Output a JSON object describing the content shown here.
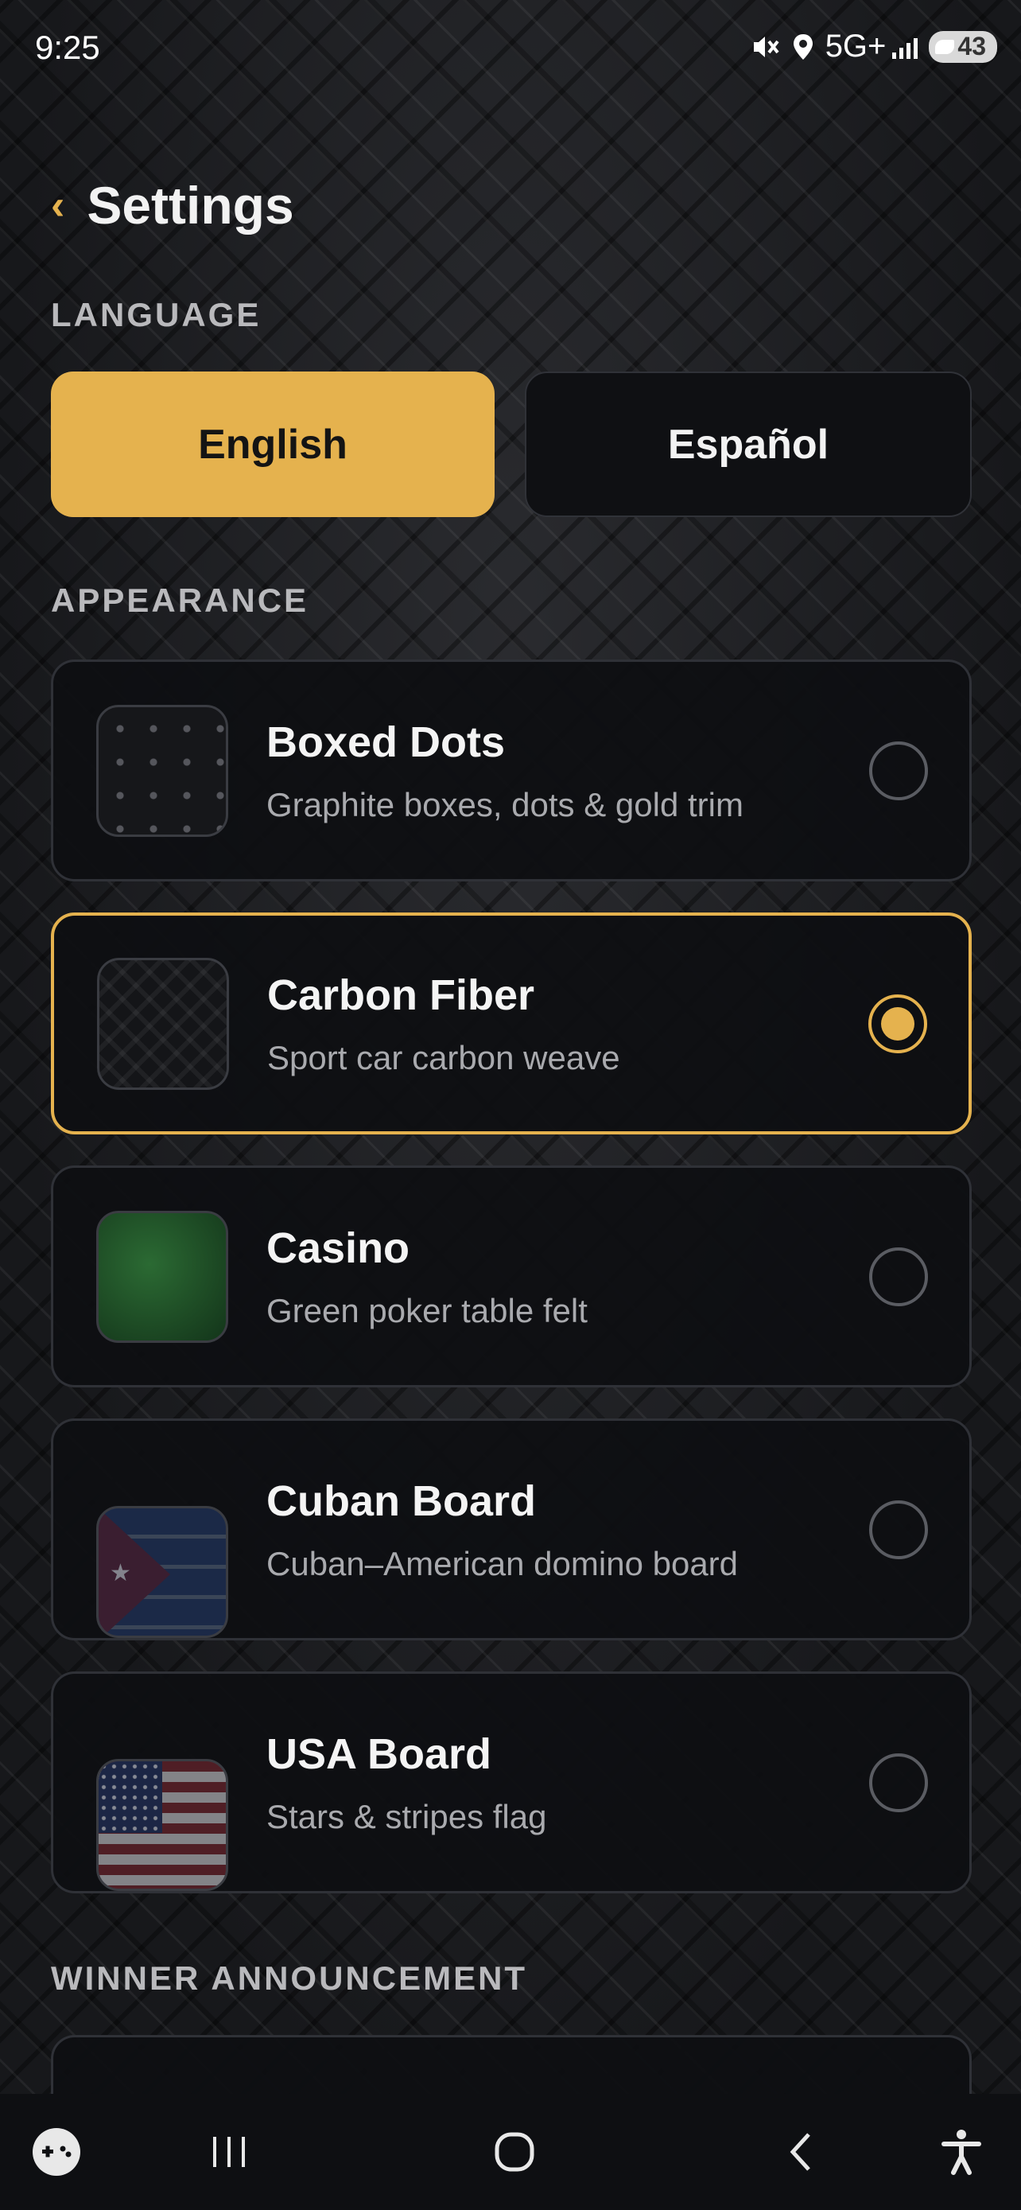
{
  "status_bar": {
    "time": "9:25",
    "network": "5G+",
    "battery": "43"
  },
  "header": {
    "title": "Settings"
  },
  "language": {
    "label": "LANGUAGE",
    "options": [
      {
        "label": "English",
        "selected": true
      },
      {
        "label": "Español",
        "selected": false
      }
    ]
  },
  "appearance": {
    "label": "APPEARANCE",
    "themes": [
      {
        "title": "Boxed Dots",
        "subtitle": "Graphite boxes, dots & gold trim",
        "selected": false,
        "thumbnail": "boxed-dots"
      },
      {
        "title": "Carbon Fiber",
        "subtitle": "Sport car carbon weave",
        "selected": true,
        "thumbnail": "carbon-fiber"
      },
      {
        "title": "Casino",
        "subtitle": "Green poker table felt",
        "selected": false,
        "thumbnail": "casino-felt"
      },
      {
        "title": "Cuban Board",
        "subtitle": "Cuban–American domino board",
        "selected": false,
        "thumbnail": "cuban-flag"
      },
      {
        "title": "USA Board",
        "subtitle": "Stars & stripes flag",
        "selected": false,
        "thumbnail": "usa-flag"
      }
    ]
  },
  "winner_announcement": {
    "label": "WINNER ANNOUNCEMENT"
  },
  "colors": {
    "accent": "#e5b24e",
    "card": "#0e0f12",
    "text_muted": "#a9aaae"
  },
  "nav_bar": {
    "icons": [
      "game-controller-icon",
      "recent-apps-icon",
      "home-icon",
      "back-icon",
      "accessibility-icon"
    ]
  }
}
